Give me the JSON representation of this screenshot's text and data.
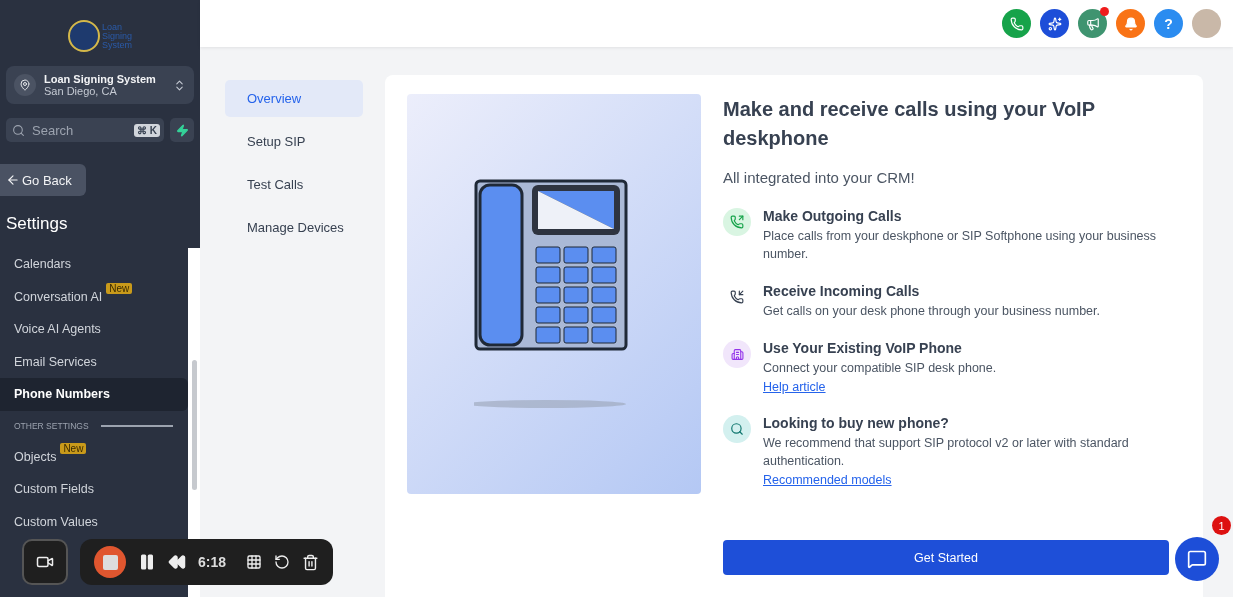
{
  "sidebar": {
    "logo_lines": [
      "Loan",
      "Signing",
      "System"
    ],
    "account": {
      "name": "Loan Signing System",
      "location": "San Diego, CA"
    },
    "search": {
      "placeholder": "Search",
      "shortcut": "⌘ K"
    },
    "back_button": "Go Back",
    "section_title": "Settings",
    "items": [
      {
        "kind": "item",
        "label": "Calendars",
        "selected": false
      },
      {
        "kind": "item",
        "label": "Conversation AI",
        "badge": "New",
        "selected": false
      },
      {
        "kind": "item",
        "label": "Voice AI Agents",
        "selected": false
      },
      {
        "kind": "item",
        "label": "Email Services",
        "selected": false
      },
      {
        "kind": "item",
        "label": "Phone Numbers",
        "selected": true
      },
      {
        "kind": "heading",
        "label": "OTHER SETTINGS"
      },
      {
        "kind": "item",
        "label": "Objects",
        "badge": "New",
        "selected": false
      },
      {
        "kind": "item",
        "label": "Custom Fields",
        "selected": false
      },
      {
        "kind": "item",
        "label": "Custom Values",
        "selected": false
      }
    ]
  },
  "header": {
    "notification_dot": true,
    "help_label": "?"
  },
  "subnav": [
    {
      "label": "Overview",
      "selected": true
    },
    {
      "label": "Setup SIP",
      "selected": false
    },
    {
      "label": "Test Calls",
      "selected": false
    },
    {
      "label": "Manage Devices",
      "selected": false
    }
  ],
  "card": {
    "title": "Make and receive calls using your VoIP deskphone",
    "subtitle": "All integrated into your CRM!",
    "features": [
      {
        "kind": "outgoing",
        "title": "Make Outgoing Calls",
        "text": "Place calls from your deskphone or SIP Softphone using your business number."
      },
      {
        "kind": "incoming",
        "title": "Receive Incoming Calls",
        "text": "Get calls on your desk phone through your business number."
      },
      {
        "kind": "building",
        "title": "Use Your Existing VoIP Phone",
        "text": "Connect your compatible SIP desk phone.",
        "link": "Help article"
      },
      {
        "kind": "search",
        "title": "Looking to buy new phone?",
        "text": "We recommend that support SIP protocol v2 or later with standard authentication.",
        "link": "Recommended models"
      }
    ],
    "button": "Get Started"
  },
  "chat": {
    "badge": "1"
  },
  "recorder": {
    "time": "6:18"
  }
}
